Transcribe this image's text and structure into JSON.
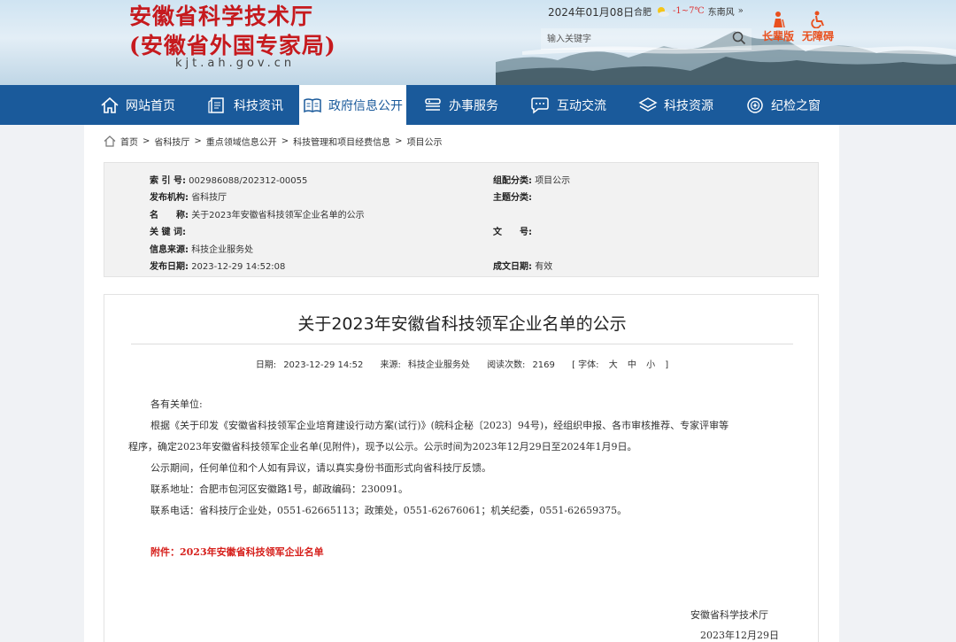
{
  "header": {
    "title_line1": "安徽省科学技术厅",
    "title_line2": "(安徽省外国专家局)",
    "domain": "kjt.ah.gov.cn",
    "date": "2024年01月08日",
    "weather_city": "合肥",
    "weather_temp": "-1~7℃",
    "weather_wind": "东南风",
    "weather_more": "»",
    "search_placeholder": "输入关键字",
    "elder_label": "长辈版",
    "barrier_free_label": "无障碍"
  },
  "nav": {
    "items": [
      {
        "label": "网站首页",
        "icon": "home-icon"
      },
      {
        "label": "科技资讯",
        "icon": "document-icon"
      },
      {
        "label": "政府信息公开",
        "icon": "book-icon",
        "active": true
      },
      {
        "label": "办事服务",
        "icon": "service-icon"
      },
      {
        "label": "互动交流",
        "icon": "chat-icon"
      },
      {
        "label": "科技资源",
        "icon": "layers-icon"
      },
      {
        "label": "纪检之窗",
        "icon": "badge-icon"
      }
    ]
  },
  "breadcrumb": [
    "首页",
    "省科技厅",
    "重点领域信息公开",
    "科技管理和项目经费信息",
    "项目公示"
  ],
  "breadcrumb_sep": ">",
  "meta": {
    "index_no_label": "索 引 号:",
    "index_no": "002986088/202312-00055",
    "category_label": "组配分类:",
    "category": "项目公示",
    "publisher_label": "发布机构:",
    "publisher": "省科技厅",
    "topic_label": "主题分类:",
    "topic": "",
    "name_label": "名　　称:",
    "name": "关于2023年安徽省科技领军企业名单的公示",
    "keywords_label": "关 键 词:",
    "keywords": "",
    "doc_no_label": "文　　号:",
    "doc_no": "",
    "source_label": "信息来源:",
    "source": "科技企业服务处",
    "pub_date_label": "发布日期:",
    "pub_date": "2023-12-29 14:52:08",
    "validity_label": "成文日期:",
    "validity": "有效"
  },
  "article": {
    "title": "关于2023年安徽省科技领军企业名单的公示",
    "date_label": "日期:",
    "date": "2023-12-29 14:52",
    "source_label": "来源:",
    "source": "科技企业服务处",
    "views_label": "阅读次数:",
    "views": "2169",
    "font_label": "[ 字体:",
    "font_large": "大",
    "font_medium": "中",
    "font_small": "小",
    "font_close": "]",
    "greeting": "各有关单位:",
    "para1_line1": "根据《关于印发《安徽省科技领军企业培育建设行动方案(试行)》(皖科企秘〔2023〕94号)，经组织申报、各市审核推荐、专家评审等",
    "para1_line2": "程序，确定2023年安徽省科技领军企业名单(见附件)，现予以公示。公示时间为2023年12月29日至2024年1月9日。",
    "para2": "公示期间，任何单位和个人如有异议，请以真实身份书面形式向省科技厅反馈。",
    "address": "联系地址：合肥市包河区安徽路1号，邮政编码：230091。",
    "phone": "联系电话：省科技厅企业处，0551-62665113；政策处，0551-62676061；机关纪委，0551-62659375。",
    "attachment": "附件：2023年安徽省科技领军企业名单",
    "signature": "安徽省科学技术厅",
    "sign_date": "2023年12月29日"
  },
  "colors": {
    "nav_bg": "#1a5a9b",
    "logo_red": "#c61a1e",
    "attachment_red": "#d6201c",
    "accessibility_orange": "#e9501e"
  }
}
